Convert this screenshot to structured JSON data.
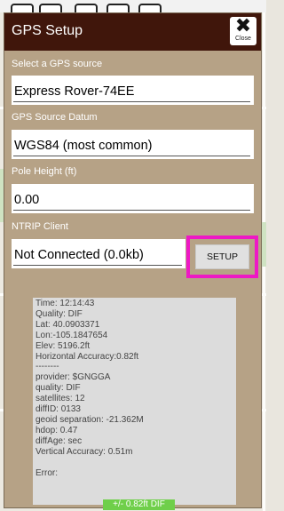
{
  "dialog": {
    "title": "GPS Setup",
    "close_label": "Close",
    "close_glyph": "✖"
  },
  "fields": {
    "source_label": "Select a GPS source",
    "source_value": "Express Rover-74EE",
    "datum_label": "GPS Source Datum",
    "datum_value": "WGS84 (most common)",
    "pole_label": "Pole Height (ft)",
    "pole_value": "0.00",
    "ntrip_label": "NTRIP Client",
    "ntrip_value": "Not Connected (0.0kb)",
    "setup_label": "SETUP"
  },
  "status_lines": [
    "Time: 12:14:43",
    "Quality: DIF",
    "Lat: 40.0903371",
    "Lon:-105.1847654",
    "Elev: 5196.2ft",
    "Horizontal Accuracy:0.82ft",
    "--------",
    "provider: $GNGGA",
    "quality: DIF",
    "satellites: 12",
    "diffID: 0133",
    "geoid separation: -21.362M",
    "hdop: 0.47",
    "diffAge: sec",
    "Vertical Accuracy: 0.51m",
    "",
    "Error:"
  ],
  "bottom_readout": "+/- 0.82ft DIF",
  "colors": {
    "header": "#40160b",
    "dialog_bg": "#b6a286",
    "highlight": "#ee18c5",
    "accuracy_badge": "#6fcf4a"
  }
}
